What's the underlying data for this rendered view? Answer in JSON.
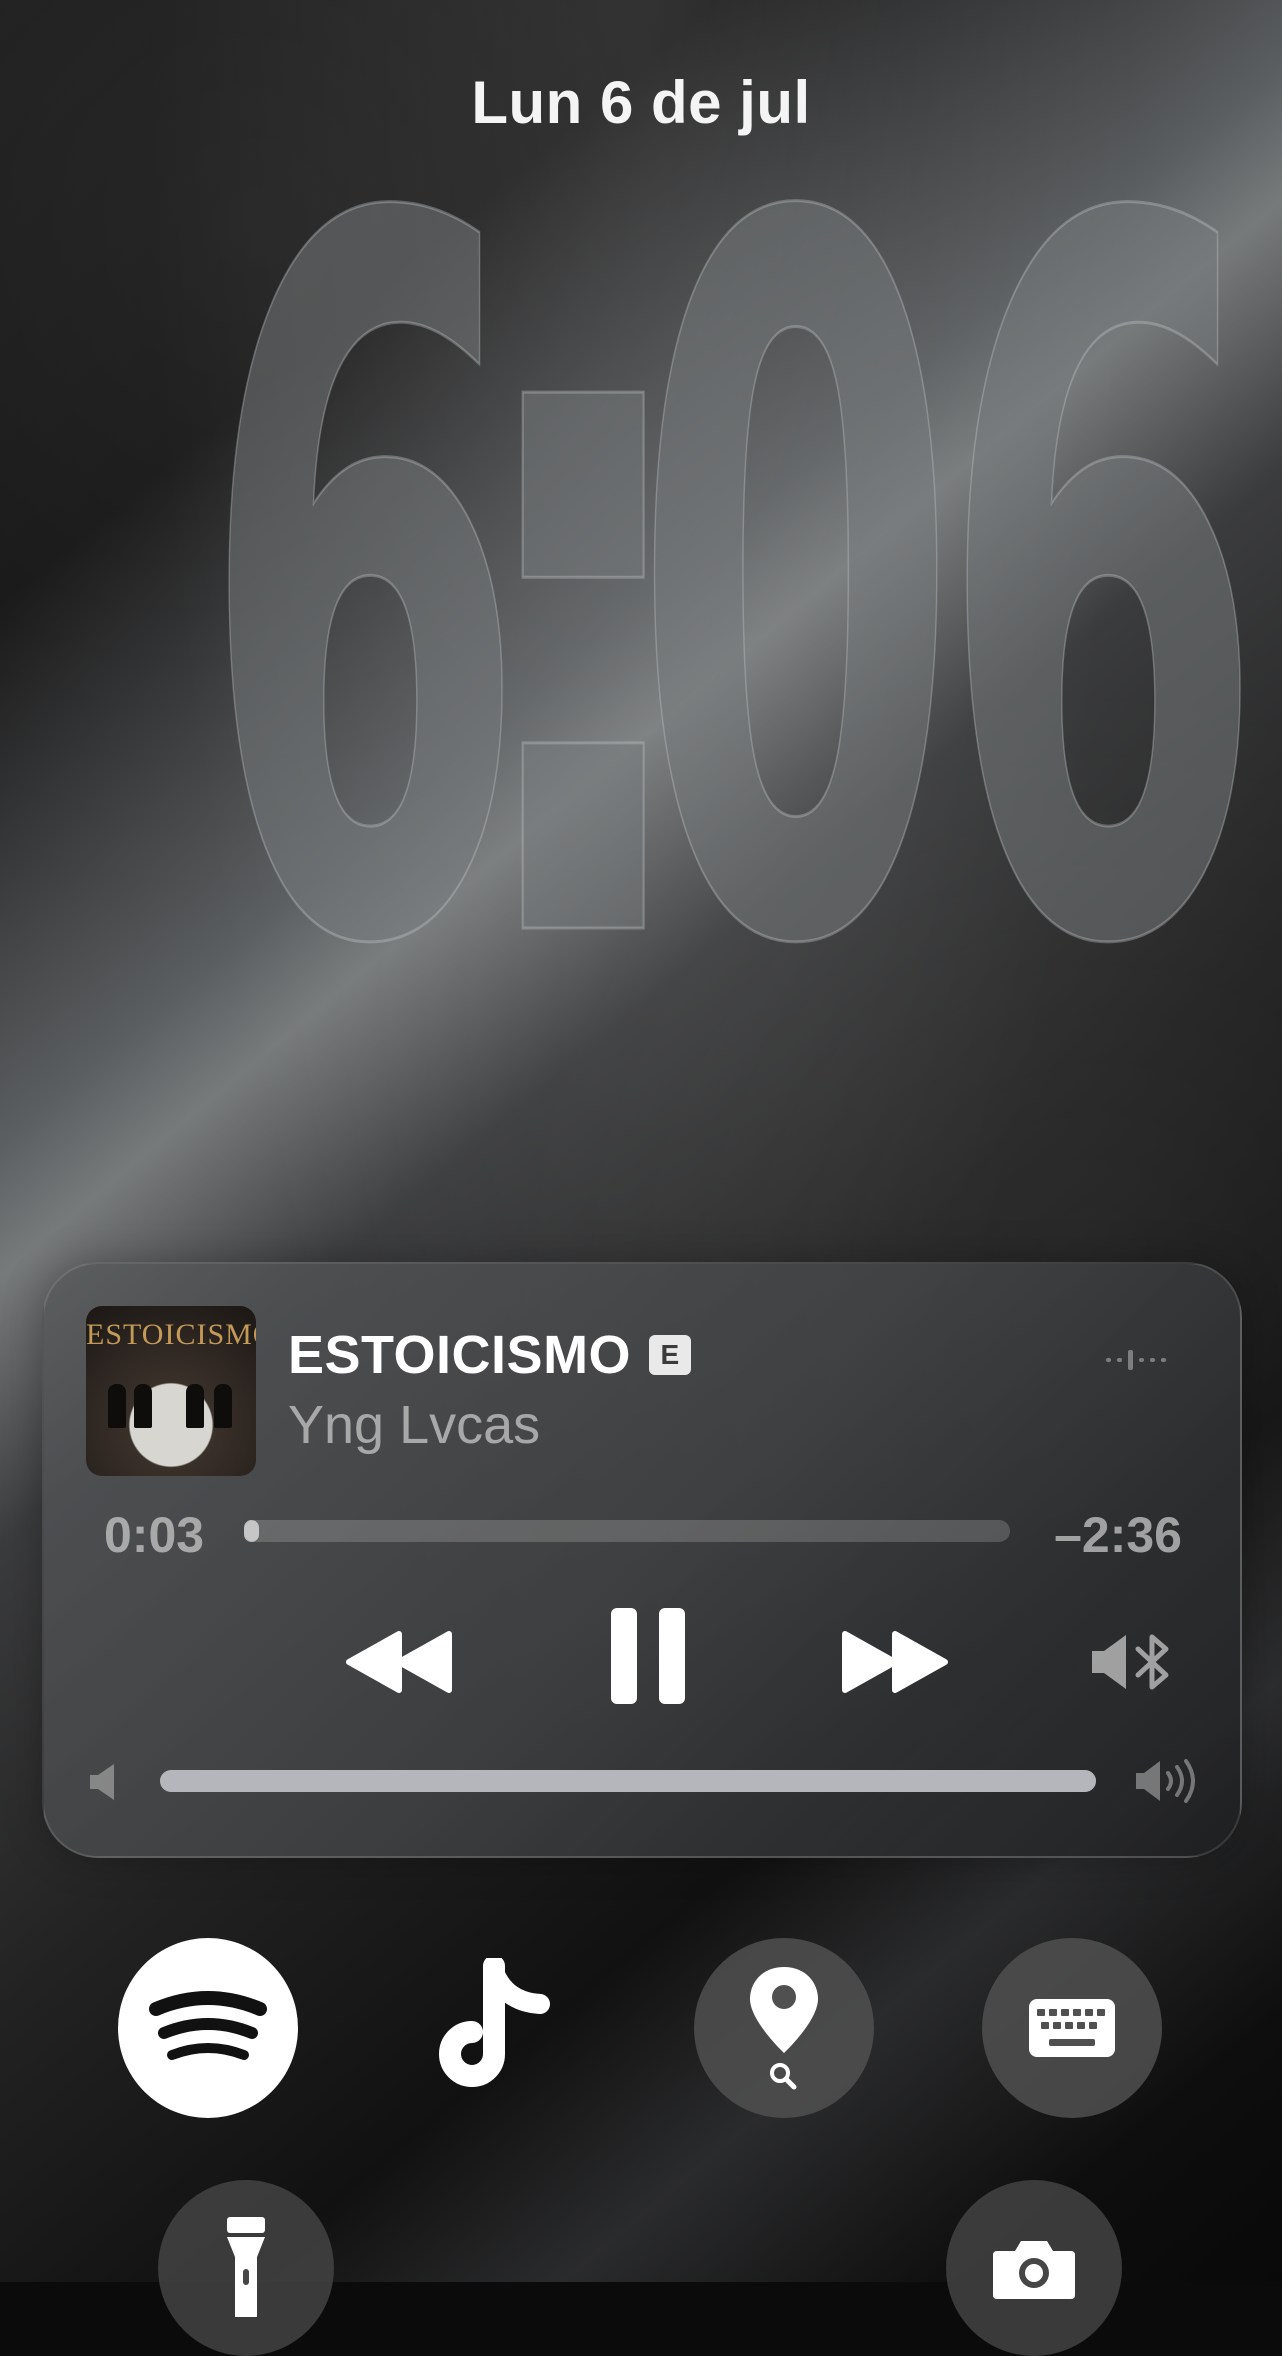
{
  "lockscreen": {
    "date": "Lun 6 de jul",
    "clock": {
      "hour": "6",
      "separator": ":",
      "minute_1": "0",
      "minute_2": "6"
    }
  },
  "now_playing": {
    "title": "ESTOICISMO",
    "explicit_badge": "E",
    "artist": "Yng Lvcas",
    "cover_title": "ESTOICISMO",
    "elapsed": "0:03",
    "remaining": "–2:36",
    "progress_fraction": 0.02,
    "volume_fraction": 1.0,
    "output_device_icon": "speaker-bluetooth-icon"
  },
  "shortcuts": [
    {
      "name": "spotify",
      "icon": "spotify-icon"
    },
    {
      "name": "tiktok",
      "icon": "tiktok-icon"
    },
    {
      "name": "find-my",
      "icon": "location-search-icon"
    },
    {
      "name": "keyboard",
      "icon": "keyboard-icon"
    }
  ],
  "bottom_controls": [
    {
      "name": "flashlight",
      "icon": "flashlight-icon"
    },
    {
      "name": "camera",
      "icon": "camera-icon"
    }
  ]
}
